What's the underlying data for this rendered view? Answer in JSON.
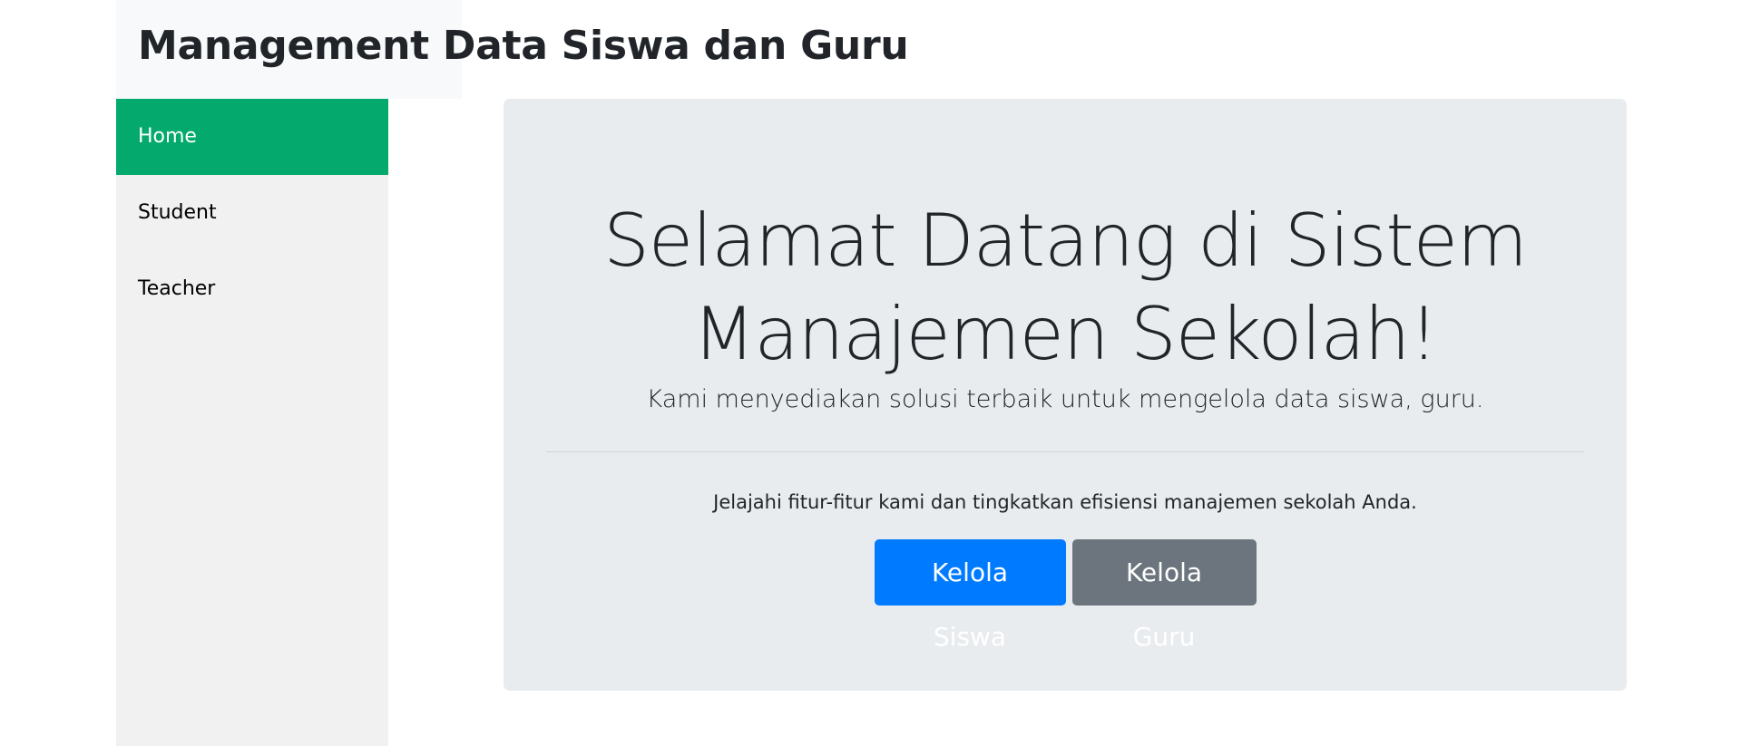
{
  "header": {
    "title": "Management Data Siswa dan Guru"
  },
  "sidebar": {
    "items": [
      {
        "label": "Home",
        "active": true
      },
      {
        "label": "Student",
        "active": false
      },
      {
        "label": "Teacher",
        "active": false
      }
    ]
  },
  "main": {
    "heading": "Selamat Datang di Sistem Manajemen Sekolah!",
    "lead": "Kami menyediakan solusi terbaik untuk mengelola data siswa, guru.",
    "body": "Jelajahi fitur-fitur kami dan tingkatkan efisiensi manajemen sekolah Anda.",
    "buttons": {
      "primary_label": "Kelola Siswa",
      "secondary_label": "Kelola Guru"
    }
  },
  "colors": {
    "active_nav": "#04aa6d",
    "primary_button": "#007bff",
    "secondary_button": "#6c757d",
    "jumbotron_bg": "#e9ecef",
    "sidebar_bg": "#f1f1f1"
  }
}
